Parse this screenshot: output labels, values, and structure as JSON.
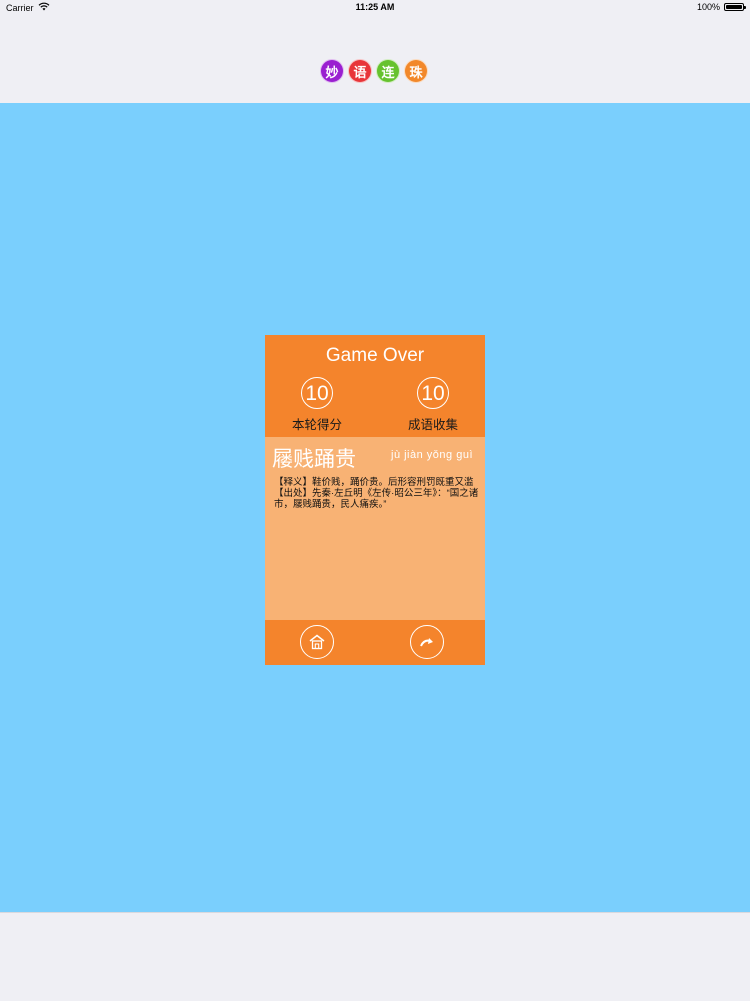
{
  "status_bar": {
    "carrier": "Carrier",
    "time": "11:25 AM",
    "battery": "100%",
    "battery_level": 1.0
  },
  "logo": {
    "chars": [
      {
        "text": "妙",
        "color": "#9a1fd0"
      },
      {
        "text": "语",
        "color": "#e8353a"
      },
      {
        "text": "连",
        "color": "#66c22e"
      },
      {
        "text": "珠",
        "color": "#f2882a"
      }
    ]
  },
  "card": {
    "title": "Game Over",
    "score": {
      "value": "10",
      "label": "本轮得分"
    },
    "collected": {
      "value": "10",
      "label": "成语收集"
    },
    "idiom": {
      "name": "屦贱踊贵",
      "pinyin": "jù jiàn yǒng guì",
      "meaning": "【释义】鞋价贱，踊价贵。后形容刑罚既重又滥",
      "source": "【出处】先秦·左丘明《左传·昭公三年》：“国之诸市，屦贱踊贵，民人痛疾。”"
    }
  },
  "colors": {
    "background": "#7acffd",
    "card_header": "#f4842c",
    "card_body": "#f8b274"
  },
  "icons": {
    "home": "home-icon",
    "next": "next-arrow-icon"
  }
}
